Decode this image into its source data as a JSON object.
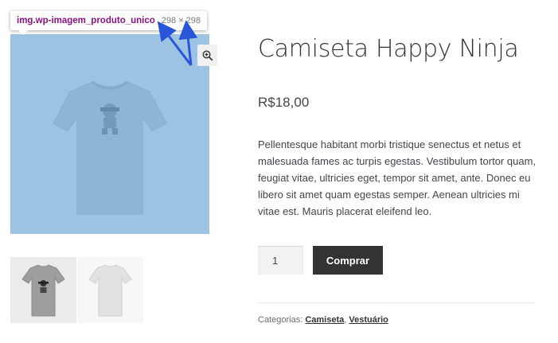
{
  "inspector_tooltip": {
    "element_name": "img.wp-imagem_produto_unico",
    "dimensions": "298 × 298"
  },
  "product": {
    "title": "Camiseta Happy Ninja",
    "price": "R$18,00",
    "description": "Pellentesque habitant morbi tristique senectus et netus et malesuada fames ac turpis egestas. Vestibulum tortor quam, feugiat vitae, ultricies eget, tempor sit amet, ante. Donec eu libero sit amet quam egestas semper. Aenean ultricies mi vitae est. Mauris placerat eleifend leo.",
    "quantity": "1",
    "buy_label": "Comprar",
    "categories_label": "Categorias:",
    "categories": [
      "Camiseta",
      "Vestuário"
    ],
    "categories_separator": ", "
  },
  "icons": {
    "zoom": "zoom-in-icon",
    "arrow": "annotation-arrow-icon"
  },
  "colors": {
    "overlay": "#6fa8dc",
    "button_bg": "#333333",
    "tooltip_name": "#881280",
    "arrow": "#2a55d6"
  }
}
